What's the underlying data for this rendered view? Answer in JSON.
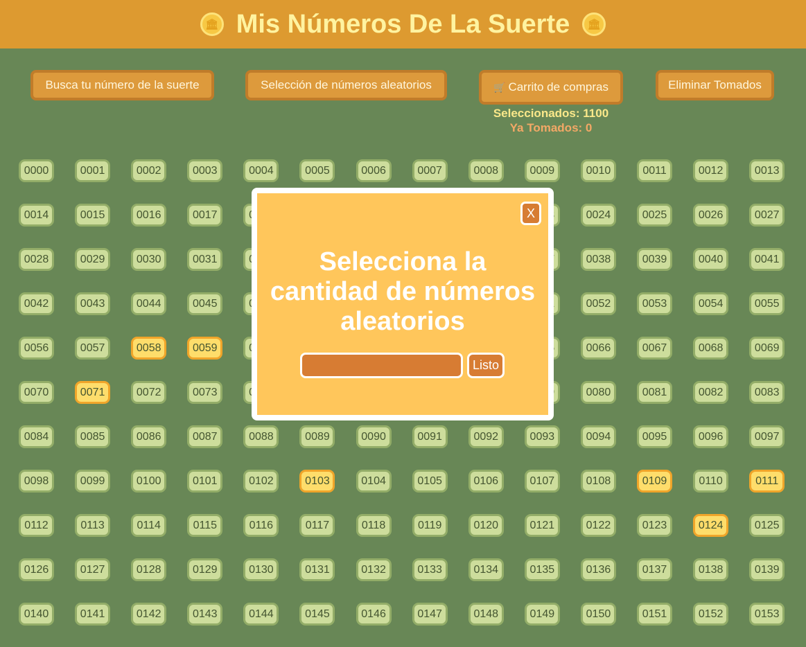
{
  "header": {
    "title": "Mis Números De La Suerte",
    "coin_icon": "🏛"
  },
  "toolbar": {
    "search_label": "Busca tu número de la suerte",
    "random_label": "Selección de números aleatorios",
    "cart_icon": "🛒",
    "cart_label": "Carrito de compras",
    "remove_label": "Eliminar Tomados"
  },
  "stats": {
    "selected": "Seleccionados: 1100",
    "taken": "Ya Tomados: 0"
  },
  "numbers": {
    "first_visible": 0,
    "last_visible": 153,
    "highlighted": [
      "0058",
      "0059",
      "0071",
      "0103",
      "0109",
      "0111",
      "0124"
    ]
  },
  "modal": {
    "close_label": "X",
    "title_line1": "Selecciona la",
    "title_line2": "cantidad de números",
    "title_line3": "aleatorios",
    "input_value": "",
    "submit_label": "Listo"
  },
  "colors": {
    "background": "#688756",
    "header": "#dd9a30",
    "number_tile": "#cddd9c",
    "number_selected": "#fedd6b",
    "modal": "#ffc65b",
    "accent": "#d77c33"
  }
}
